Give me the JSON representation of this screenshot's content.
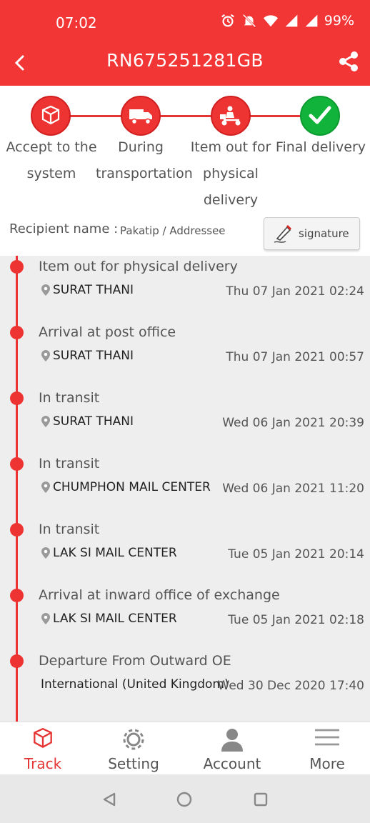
{
  "status_bar": {
    "time": "07:02",
    "battery": "99%"
  },
  "header": {
    "title": "RN675251281GB"
  },
  "steps": [
    {
      "label": "Accept to the system"
    },
    {
      "label": "During transportation"
    },
    {
      "label": "Item out for physical delivery"
    },
    {
      "label": "Final delivery"
    }
  ],
  "recipient": {
    "label": "Recipient name :",
    "value": "Pakatip / Addressee",
    "signature_label": "signature"
  },
  "events": [
    {
      "title": "Item out for physical delivery",
      "location": "SURAT THANI",
      "time": "Thu 07 Jan 2021 02:24",
      "pin": true
    },
    {
      "title": "Arrival at post office",
      "location": "SURAT THANI",
      "time": "Thu 07 Jan 2021 00:57",
      "pin": true
    },
    {
      "title": "In transit",
      "location": "SURAT THANI",
      "time": "Wed 06 Jan 2021 20:39",
      "pin": true
    },
    {
      "title": "In transit",
      "location": "CHUMPHON MAIL CENTER",
      "time": "Wed 06 Jan 2021 11:20",
      "pin": true
    },
    {
      "title": "In transit",
      "location": "LAK SI MAIL CENTER",
      "time": "Tue 05 Jan 2021 20:14",
      "pin": true
    },
    {
      "title": "Arrival at inward office of exchange",
      "location": "LAK SI MAIL CENTER",
      "time": "Tue 05 Jan 2021 02:18",
      "pin": true
    },
    {
      "title": "Departure From Outward OE",
      "location": "International (United Kingdom)",
      "time": "Wed 30 Dec 2020 17:40",
      "pin": false
    }
  ],
  "bottom_nav": {
    "track": "Track",
    "setting": "Setting",
    "account": "Account",
    "more": "More"
  },
  "colors": {
    "brand": "#f23535",
    "done": "#12b33a"
  }
}
